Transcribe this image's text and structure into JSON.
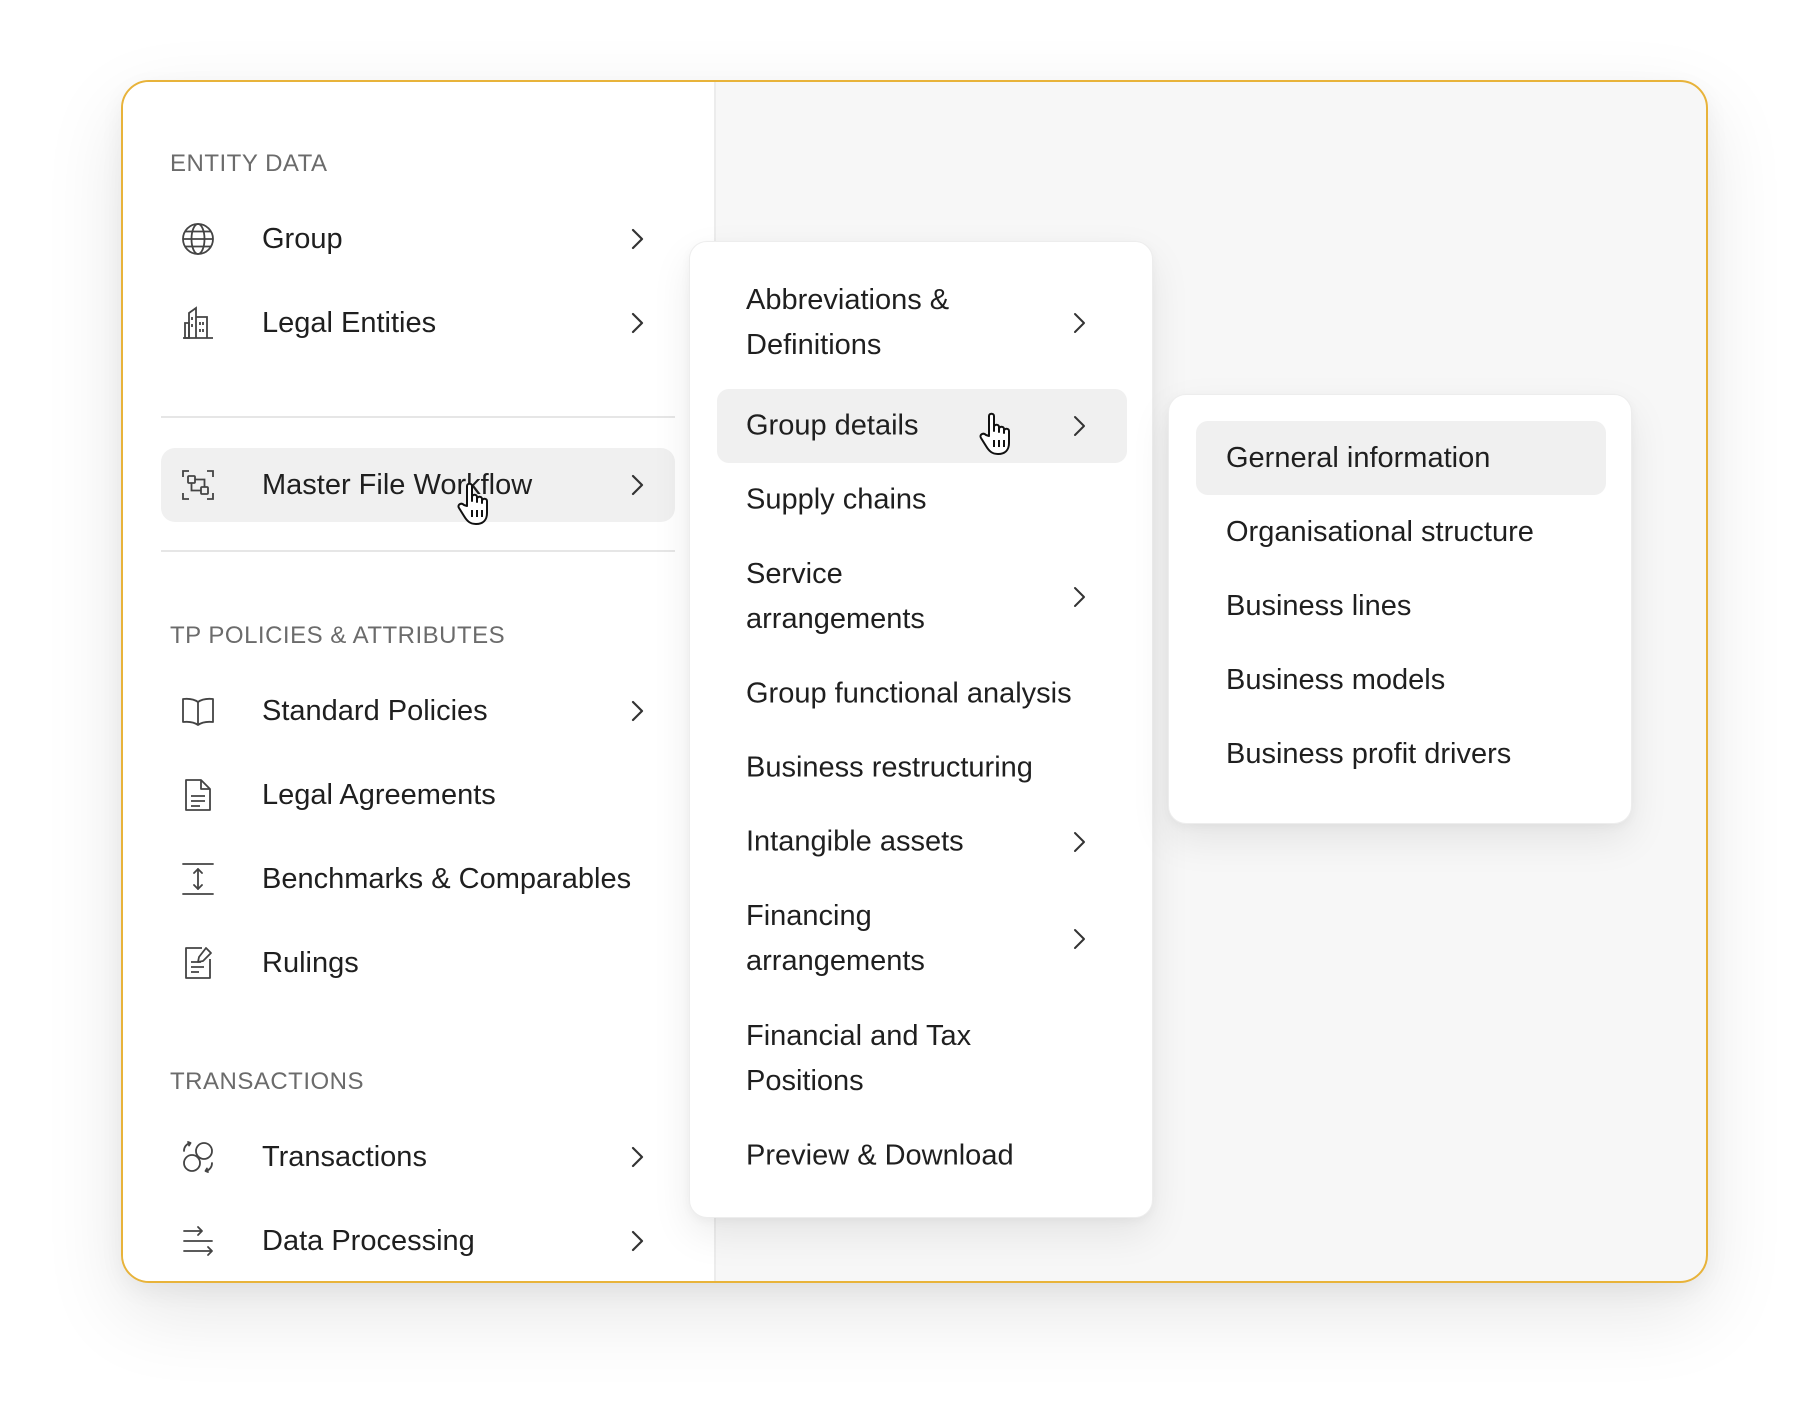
{
  "sidebar": {
    "sections": {
      "entity_data": "ENTITY DATA",
      "tp_policies": "TP POLICIES & ATTRIBUTES",
      "transactions": "TRANSACTIONS"
    },
    "items": {
      "group": "Group",
      "legal_entities": "Legal Entities",
      "master_file_workflow": "Master File Workflow",
      "standard_policies": "Standard Policies",
      "legal_agreements": "Legal Agreements",
      "benchmarks": "Benchmarks & Comparables",
      "rulings": "Rulings",
      "transactions": "Transactions",
      "data_processing": "Data Processing"
    },
    "active_item": "Master File Workflow"
  },
  "master_file_menu": {
    "items": [
      {
        "label": "Abbreviations & Definitions",
        "has_submenu": true
      },
      {
        "label": "Group details",
        "has_submenu": true,
        "active": true
      },
      {
        "label": "Supply chains",
        "has_submenu": false
      },
      {
        "label": "Service arrangements",
        "has_submenu": true
      },
      {
        "label": "Group functional analysis",
        "has_submenu": false
      },
      {
        "label": "Business restructuring",
        "has_submenu": false
      },
      {
        "label": "Intangible assets",
        "has_submenu": true
      },
      {
        "label": "Financing arrangements",
        "has_submenu": true
      },
      {
        "label": "Financial and Tax Positions",
        "has_submenu": false
      },
      {
        "label": "Preview & Download",
        "has_submenu": false
      }
    ]
  },
  "group_details_menu": {
    "items": [
      {
        "label": "Gerneral information",
        "active": true
      },
      {
        "label": "Organisational structure"
      },
      {
        "label": "Business lines"
      },
      {
        "label": "Business models"
      },
      {
        "label": "Business profit drivers"
      }
    ]
  },
  "icons": {
    "group": "globe-icon",
    "legal_entities": "building-icon",
    "master_file_workflow": "scan-workflow-icon",
    "standard_policies": "book-icon",
    "legal_agreements": "document-icon",
    "benchmarks": "vertical-measure-icon",
    "rulings": "document-edit-icon",
    "transactions": "exchange-icon",
    "data_processing": "arrows-right-icon",
    "submenu": "chevron-right-icon",
    "cursor": "hand-pointer-icon"
  },
  "colors": {
    "frame_border": "#e8b33a",
    "active_bg": "#f0f0f0",
    "background": "#f7f7f7",
    "section_title": "#6b6b6b"
  }
}
